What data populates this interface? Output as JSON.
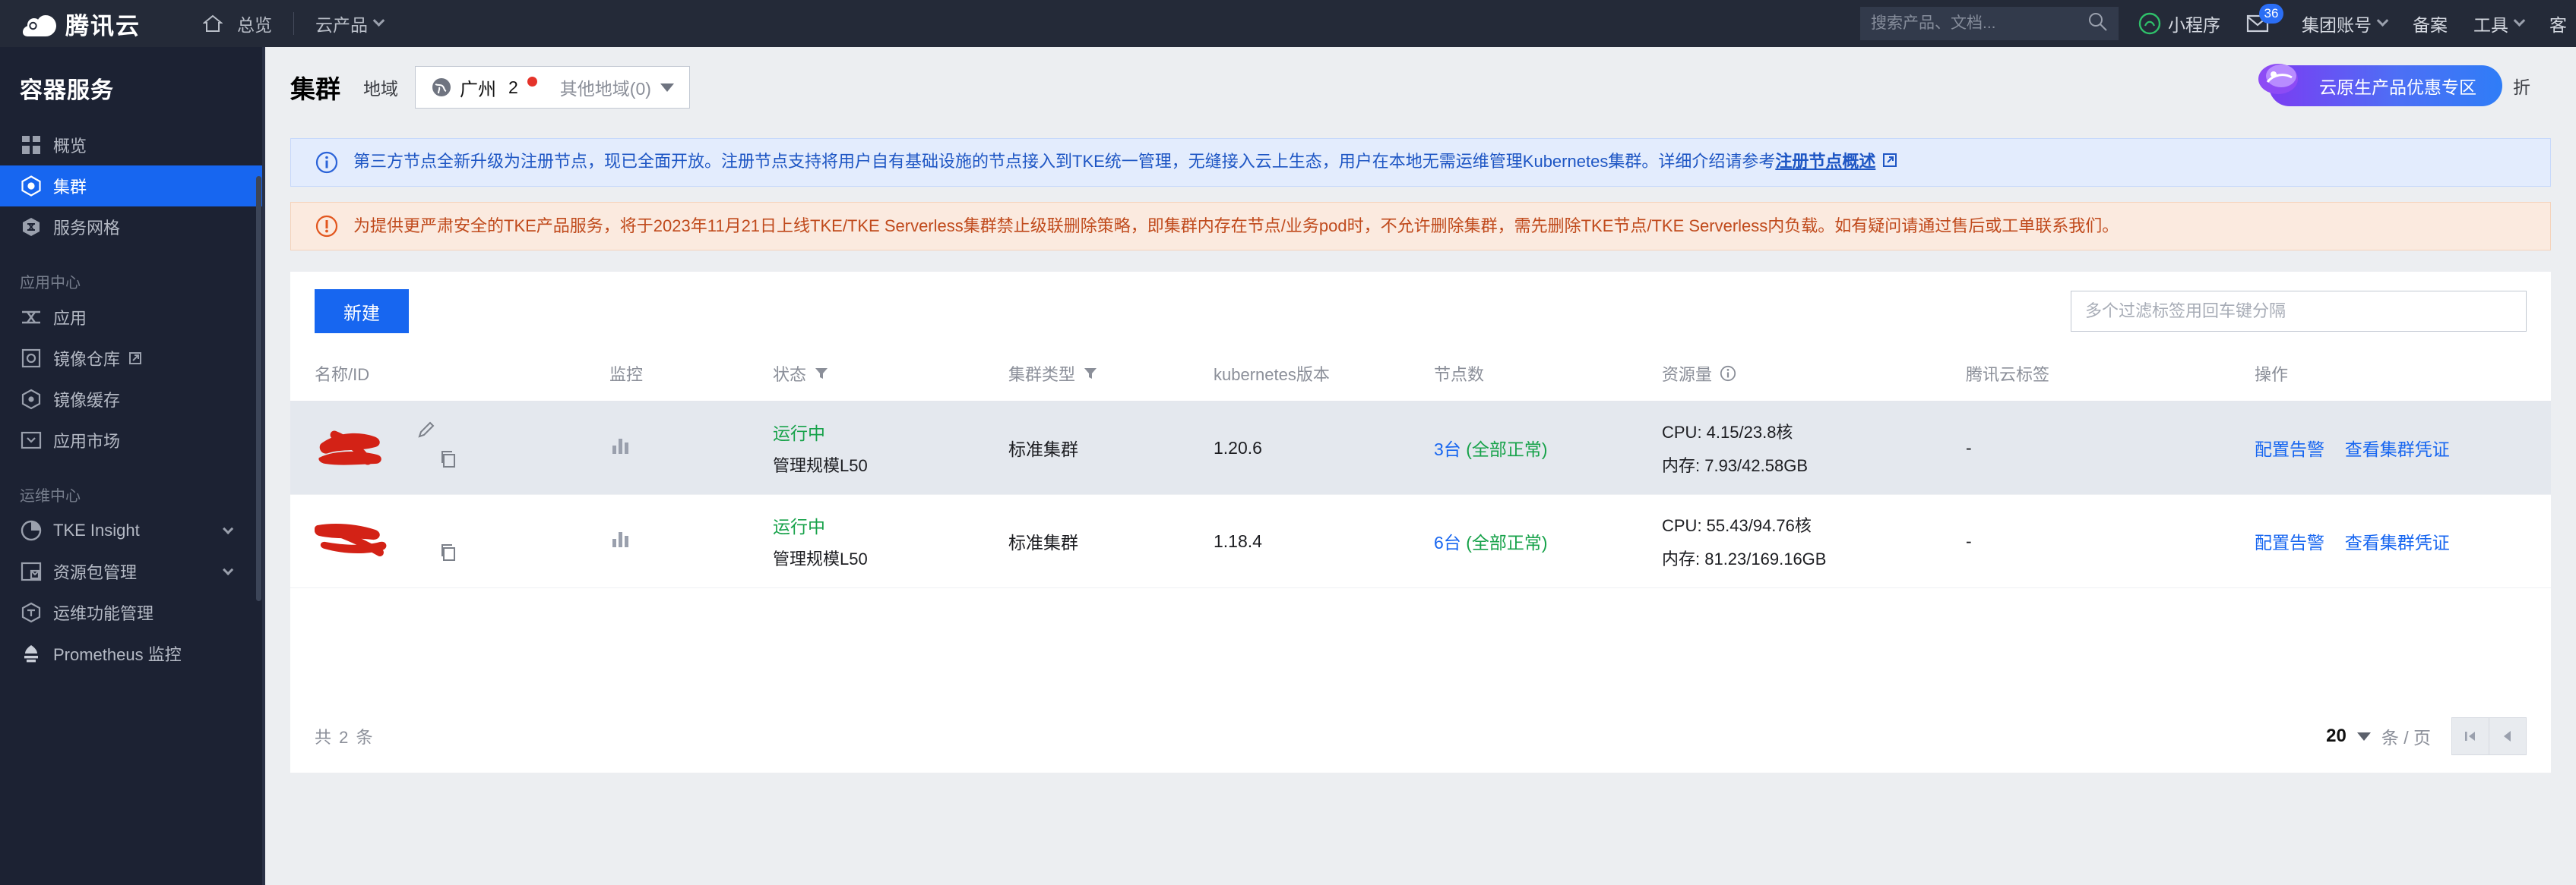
{
  "topnav": {
    "brand": "腾讯云",
    "home": "总览",
    "products": "云产品",
    "search_placeholder": "搜索产品、文档...",
    "miniprogram": "小程序",
    "mail_badge": "36",
    "group_account": "集团账号",
    "filing": "备案",
    "tools": "工具",
    "support": "客"
  },
  "sidebar": {
    "title": "容器服务",
    "items": [
      {
        "label": "概览",
        "icon": "grid-icon",
        "active": false,
        "external": false,
        "chevron": false
      },
      {
        "label": "集群",
        "icon": "cluster-icon",
        "active": true,
        "external": false,
        "chevron": false
      },
      {
        "label": "服务网格",
        "icon": "mesh-icon",
        "active": false,
        "external": false,
        "chevron": false
      }
    ],
    "group_app_center": "应用中心",
    "app_items": [
      {
        "label": "应用",
        "icon": "app-icon",
        "external": false,
        "chevron": false
      },
      {
        "label": "镜像仓库",
        "icon": "registry-icon",
        "external": true,
        "chevron": false
      },
      {
        "label": "镜像缓存",
        "icon": "image-cache-icon",
        "external": false,
        "chevron": false
      },
      {
        "label": "应用市场",
        "icon": "marketplace-icon",
        "external": false,
        "chevron": false
      }
    ],
    "group_ops_center": "运维中心",
    "ops_items": [
      {
        "label": "TKE Insight",
        "icon": "insight-icon",
        "external": false,
        "chevron": true
      },
      {
        "label": "资源包管理",
        "icon": "package-icon",
        "external": false,
        "chevron": true
      },
      {
        "label": "运维功能管理",
        "icon": "ops-icon",
        "external": false,
        "chevron": false
      },
      {
        "label": "Prometheus 监控",
        "icon": "prometheus-icon",
        "external": false,
        "chevron": false
      }
    ]
  },
  "page": {
    "title": "集群",
    "region_label": "地域",
    "region_current": "广州",
    "region_count": "2",
    "region_other": "其他地域(0)"
  },
  "banners": {
    "info_text_before": "第三方节点全新升级为注册节点，现已全面开放。注册节点支持将用户自有基础设施的节点接入到TKE统一管理，无缝接入云上生态，用户在本地无需运维管理Kubernetes集群。详细介绍请参考",
    "info_link": "注册节点概述",
    "warn_text": "为提供更严肃安全的TKE产品服务，将于2023年11月21日上线TKE/TKE Serverless集群禁止级联删除策略，即集群内存在节点/业务pod时，不允许删除集群，需先删除TKE节点/TKE Serverless内负载。如有疑问请通过售后或工单联系我们。"
  },
  "toolbar": {
    "new_button": "新建",
    "filter_placeholder": "多个过滤标签用回车键分隔"
  },
  "promo": {
    "text": "云原生产品优惠专区",
    "tail": "折"
  },
  "table": {
    "columns": [
      {
        "label": "名称/ID",
        "filter": false,
        "info": false
      },
      {
        "label": "监控",
        "filter": false,
        "info": false
      },
      {
        "label": "状态",
        "filter": true,
        "info": false
      },
      {
        "label": "集群类型",
        "filter": true,
        "info": false
      },
      {
        "label": "kubernetes版本",
        "filter": false,
        "info": false
      },
      {
        "label": "节点数",
        "filter": false,
        "info": false
      },
      {
        "label": "资源量",
        "filter": false,
        "info": true
      },
      {
        "label": "腾讯云标签",
        "filter": false,
        "info": false
      },
      {
        "label": "操作",
        "filter": false,
        "info": false
      }
    ],
    "rows": [
      {
        "name": "",
        "status": "运行中",
        "status_sub": "管理规模L50",
        "cluster_type": "标准集群",
        "k8s_version": "1.20.6",
        "node_count": "3台",
        "node_state": "(全部正常)",
        "cpu": "CPU: 4.15/23.8核",
        "memory": "内存: 7.93/42.58GB",
        "tags": "-",
        "op_alarm": "配置告警",
        "op_cred": "查看集群凭证",
        "hover": true
      },
      {
        "name": "",
        "status": "运行中",
        "status_sub": "管理规模L50",
        "cluster_type": "标准集群",
        "k8s_version": "1.18.4",
        "node_count": "6台",
        "node_state": "(全部正常)",
        "cpu": "CPU: 55.43/94.76核",
        "memory": "内存: 81.23/169.16GB",
        "tags": "-",
        "op_alarm": "配置告警",
        "op_cred": "查看集群凭证",
        "hover": false
      }
    ]
  },
  "footer": {
    "total": "共 2 条",
    "page_size": "20",
    "page_unit": "条 / 页"
  },
  "colors": {
    "accent_blue": "#1766f0",
    "nav_bg": "#242a38",
    "sidebar_bg": "#1c2233",
    "status_green": "#17a24a",
    "warn_orange": "#c04a1c",
    "info_blue": "#1e56c4",
    "redact_red": "#d32216"
  }
}
